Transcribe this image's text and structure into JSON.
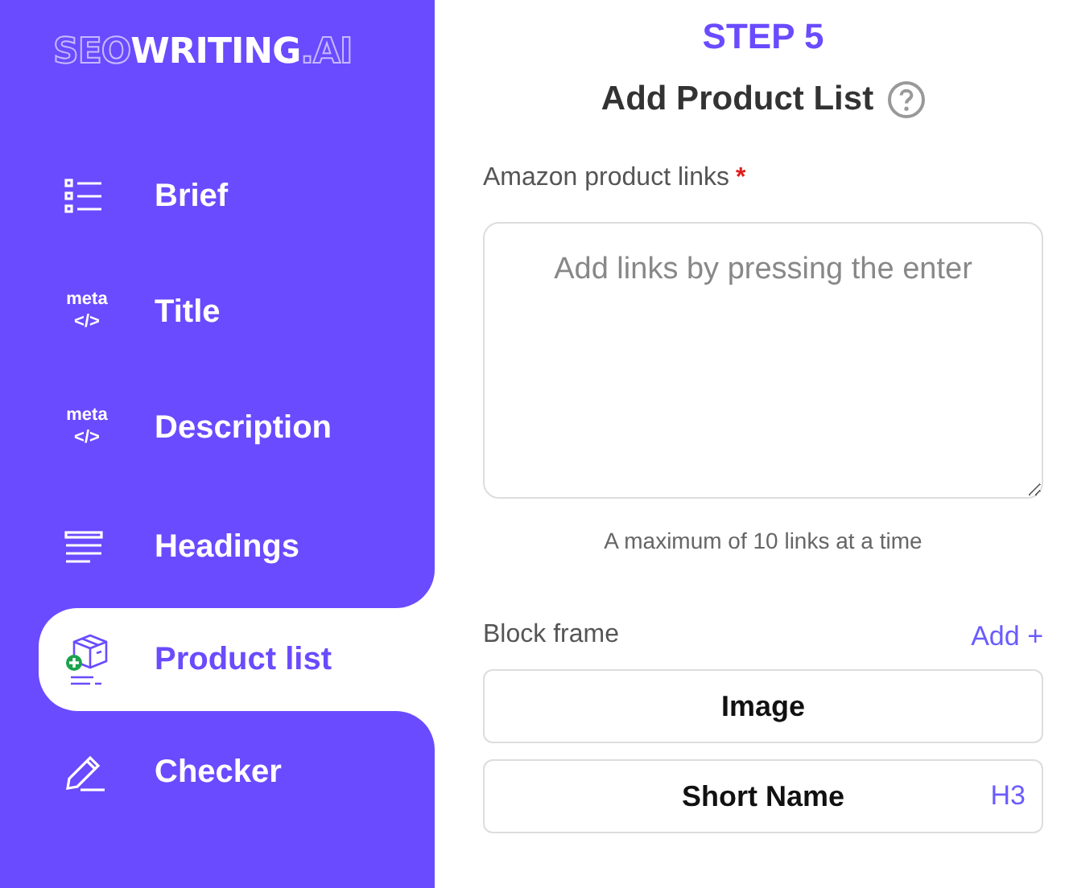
{
  "logo": [
    {
      "text": "SEO",
      "outline": true
    },
    {
      "text": "WRITING",
      "outline": false
    },
    {
      "text": ".AI",
      "outline": true
    }
  ],
  "nav": [
    {
      "label": "Brief",
      "kind": "list",
      "selected": false
    },
    {
      "label": "Title",
      "kind": "meta",
      "icon_text": "meta\n</>",
      "selected": false
    },
    {
      "label": "Description",
      "kind": "meta",
      "icon_text": "meta\n</>",
      "selected": false
    },
    {
      "label": "Headings",
      "kind": "headings",
      "selected": false
    },
    {
      "label": "Product list",
      "kind": "box",
      "selected": true
    },
    {
      "label": "Checker",
      "kind": "pencil",
      "selected": false
    }
  ],
  "step": "STEP 5",
  "heading": "Add Product List",
  "links_field": {
    "label": "Amazon product links",
    "required_mark": "*",
    "placeholder": "Add links by pressing the enter",
    "hint": "A maximum of 10 links at a time"
  },
  "block_frame": {
    "label": "Block frame",
    "add": "Add +",
    "blocks": [
      {
        "name": "Image"
      },
      {
        "name": "Short Name",
        "tag": "H3"
      }
    ]
  }
}
